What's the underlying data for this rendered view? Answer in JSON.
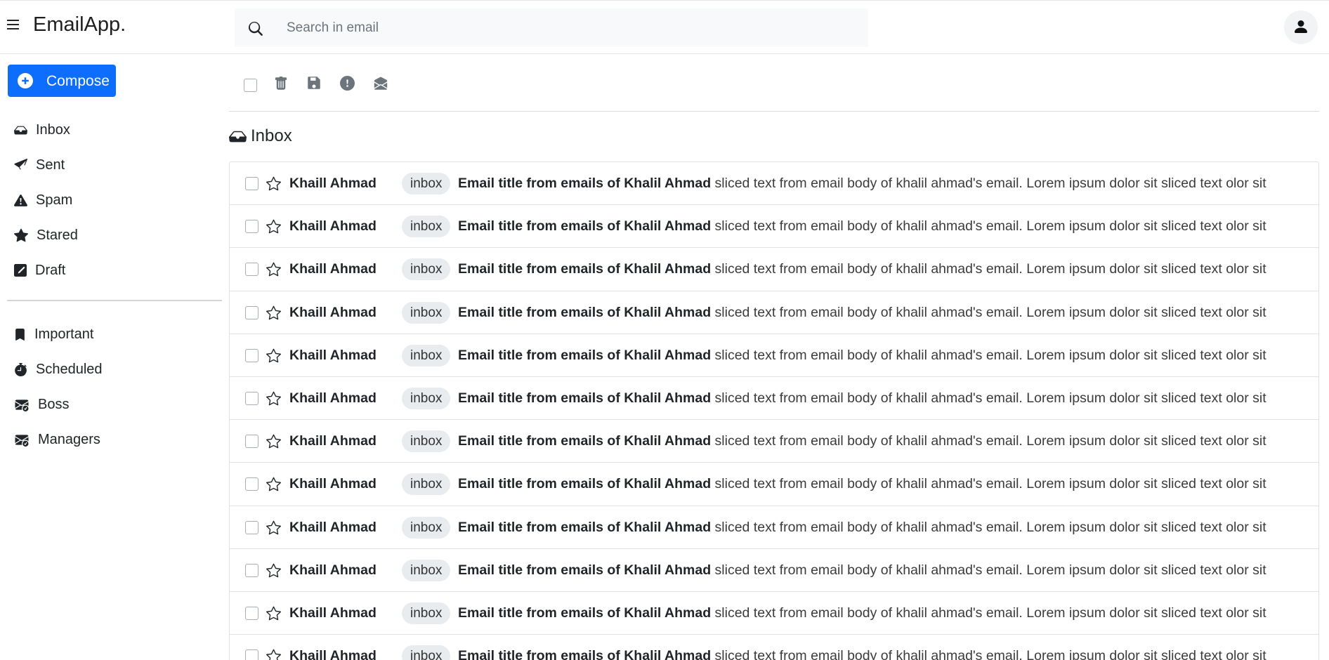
{
  "app": {
    "brand": "EmailApp."
  },
  "search": {
    "placeholder": "Search in email"
  },
  "sidebar": {
    "compose_label": "Compose",
    "primary": [
      {
        "label": "Inbox",
        "icon": "inbox-icon"
      },
      {
        "label": "Sent",
        "icon": "paper-plane-icon"
      },
      {
        "label": "Spam",
        "icon": "warning-icon"
      },
      {
        "label": "Stared",
        "icon": "star-icon"
      },
      {
        "label": "Draft",
        "icon": "pencil-square-icon"
      }
    ],
    "secondary": [
      {
        "label": "Important",
        "icon": "bookmark-icon"
      },
      {
        "label": "Scheduled",
        "icon": "stopwatch-icon"
      },
      {
        "label": "Boss",
        "icon": "envelope-check-icon"
      },
      {
        "label": "Managers",
        "icon": "envelope-check-icon"
      }
    ]
  },
  "toolbar": {
    "icons": [
      "trash-icon",
      "save-icon",
      "alert-circle-icon",
      "envelope-open-icon"
    ]
  },
  "main": {
    "title": "Inbox",
    "title_icon": "inbox-icon"
  },
  "emails": [
    {
      "sender": "Khaill Ahmad",
      "tag": "inbox",
      "title": "Email title from emails of Khalil Ahmad",
      "snippet": "sliced text from email body of khalil ahmad's email. Lorem ipsum dolor sit sliced text olor sit"
    },
    {
      "sender": "Khaill Ahmad",
      "tag": "inbox",
      "title": "Email title from emails of Khalil Ahmad",
      "snippet": "sliced text from email body of khalil ahmad's email. Lorem ipsum dolor sit sliced text olor sit"
    },
    {
      "sender": "Khaill Ahmad",
      "tag": "inbox",
      "title": "Email title from emails of Khalil Ahmad",
      "snippet": "sliced text from email body of khalil ahmad's email. Lorem ipsum dolor sit sliced text olor sit"
    },
    {
      "sender": "Khaill Ahmad",
      "tag": "inbox",
      "title": "Email title from emails of Khalil Ahmad",
      "snippet": "sliced text from email body of khalil ahmad's email. Lorem ipsum dolor sit sliced text olor sit"
    },
    {
      "sender": "Khaill Ahmad",
      "tag": "inbox",
      "title": "Email title from emails of Khalil Ahmad",
      "snippet": "sliced text from email body of khalil ahmad's email. Lorem ipsum dolor sit sliced text olor sit"
    },
    {
      "sender": "Khaill Ahmad",
      "tag": "inbox",
      "title": "Email title from emails of Khalil Ahmad",
      "snippet": "sliced text from email body of khalil ahmad's email. Lorem ipsum dolor sit sliced text olor sit"
    },
    {
      "sender": "Khaill Ahmad",
      "tag": "inbox",
      "title": "Email title from emails of Khalil Ahmad",
      "snippet": "sliced text from email body of khalil ahmad's email. Lorem ipsum dolor sit sliced text olor sit"
    },
    {
      "sender": "Khaill Ahmad",
      "tag": "inbox",
      "title": "Email title from emails of Khalil Ahmad",
      "snippet": "sliced text from email body of khalil ahmad's email. Lorem ipsum dolor sit sliced text olor sit"
    },
    {
      "sender": "Khaill Ahmad",
      "tag": "inbox",
      "title": "Email title from emails of Khalil Ahmad",
      "snippet": "sliced text from email body of khalil ahmad's email. Lorem ipsum dolor sit sliced text olor sit"
    },
    {
      "sender": "Khaill Ahmad",
      "tag": "inbox",
      "title": "Email title from emails of Khalil Ahmad",
      "snippet": "sliced text from email body of khalil ahmad's email. Lorem ipsum dolor sit sliced text olor sit"
    },
    {
      "sender": "Khaill Ahmad",
      "tag": "inbox",
      "title": "Email title from emails of Khalil Ahmad",
      "snippet": "sliced text from email body of khalil ahmad's email. Lorem ipsum dolor sit sliced text olor sit"
    },
    {
      "sender": "Khaill Ahmad",
      "tag": "inbox",
      "title": "Email title from emails of Khalil Ahmad",
      "snippet": "sliced text from email body of khalil ahmad's email. Lorem ipsum dolor sit sliced text olor sit"
    }
  ],
  "colors": {
    "primary": "#0d6efd",
    "badge_bg": "#e9ecef",
    "search_bg": "#f8f9fa"
  }
}
